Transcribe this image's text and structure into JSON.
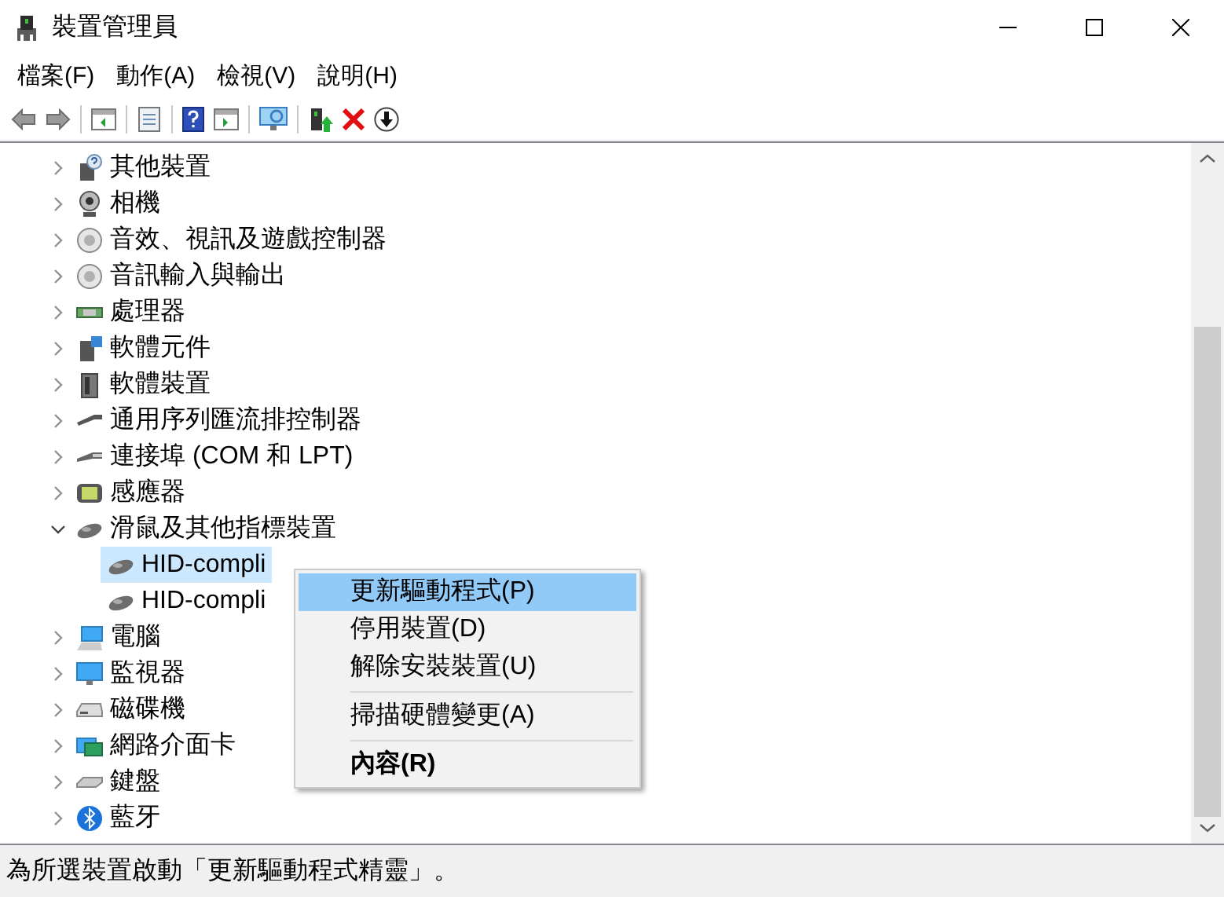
{
  "window": {
    "title": "裝置管理員"
  },
  "menu": [
    {
      "label": "檔案(F)"
    },
    {
      "label": "動作(A)"
    },
    {
      "label": "檢視(V)"
    },
    {
      "label": "說明(H)"
    }
  ],
  "tree": [
    {
      "label": "其他裝置",
      "kind": "unknown",
      "expanded": false
    },
    {
      "label": "相機",
      "kind": "camera",
      "expanded": false
    },
    {
      "label": "音效、視訊及遊戲控制器",
      "kind": "audio",
      "expanded": false
    },
    {
      "label": "音訊輸入與輸出",
      "kind": "audio",
      "expanded": false
    },
    {
      "label": "處理器",
      "kind": "processor",
      "expanded": false
    },
    {
      "label": "軟體元件",
      "kind": "component",
      "expanded": false
    },
    {
      "label": "軟體裝置",
      "kind": "device",
      "expanded": false
    },
    {
      "label": "通用序列匯流排控制器",
      "kind": "usb",
      "expanded": false
    },
    {
      "label": "連接埠 (COM 和 LPT)",
      "kind": "port",
      "expanded": false
    },
    {
      "label": "感應器",
      "kind": "sensor",
      "expanded": false
    },
    {
      "label": "滑鼠及其他指標裝置",
      "kind": "mouse",
      "expanded": true,
      "children": [
        {
          "label": "HID-compli",
          "kind": "mouse",
          "selected": true
        },
        {
          "label": "HID-compli",
          "kind": "mouse",
          "selected": false
        }
      ]
    },
    {
      "label": "電腦",
      "kind": "computer",
      "expanded": false
    },
    {
      "label": "監視器",
      "kind": "monitor",
      "expanded": false
    },
    {
      "label": "磁碟機",
      "kind": "disk",
      "expanded": false
    },
    {
      "label": "網路介面卡",
      "kind": "network",
      "expanded": false
    },
    {
      "label": "鍵盤",
      "kind": "keyboard",
      "expanded": false
    },
    {
      "label": "藍牙",
      "kind": "bluetooth",
      "expanded": false
    }
  ],
  "context_menu": [
    {
      "kind": "item",
      "label": "更新驅動程式(P)",
      "highlighted": true,
      "default": false
    },
    {
      "kind": "item",
      "label": "停用裝置(D)",
      "highlighted": false,
      "default": false
    },
    {
      "kind": "item",
      "label": "解除安裝裝置(U)",
      "highlighted": false,
      "default": false
    },
    {
      "kind": "separator"
    },
    {
      "kind": "item",
      "label": "掃描硬體變更(A)",
      "highlighted": false,
      "default": false
    },
    {
      "kind": "separator"
    },
    {
      "kind": "item",
      "label": "內容(R)",
      "highlighted": false,
      "default": true
    }
  ],
  "status_bar": "為所選裝置啟動「更新驅動程式精靈」。"
}
